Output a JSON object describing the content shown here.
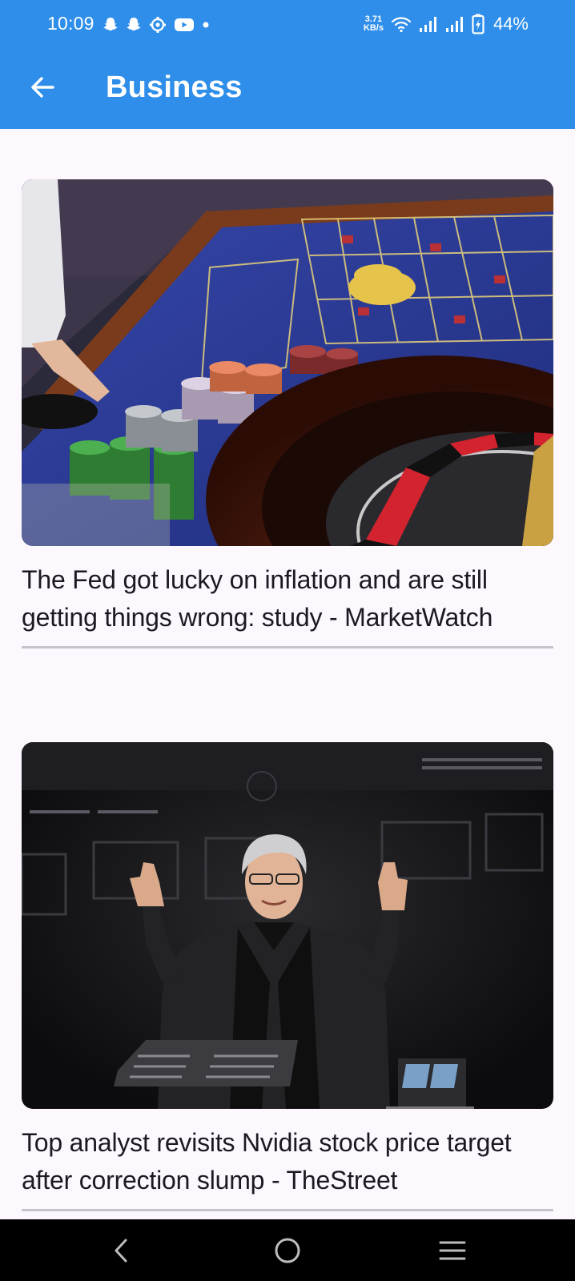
{
  "status_bar": {
    "time": "10:09",
    "net_speed_value": "3.71",
    "net_speed_unit": "KB/s",
    "battery_percent": "44%"
  },
  "app_bar": {
    "title": "Business",
    "back_icon": "arrow-left-icon"
  },
  "articles": [
    {
      "headline": "The Fed got lucky on inflation and are still getting things wrong: study - MarketWatch",
      "image": "roulette-table-photo"
    },
    {
      "headline": "Top analyst revisits Nvidia stock price target after correction slump - TheStreet",
      "image": "nvidia-ceo-keynote-photo"
    }
  ],
  "nav_bar": {
    "back_icon": "chevron-left-icon",
    "home_icon": "circle-home-icon",
    "recents_icon": "menu-lines-icon"
  },
  "colors": {
    "primary": "#2e8ee9",
    "background": "#fdf7fe",
    "text": "#1c1a20",
    "divider": "#c8c3cb"
  }
}
